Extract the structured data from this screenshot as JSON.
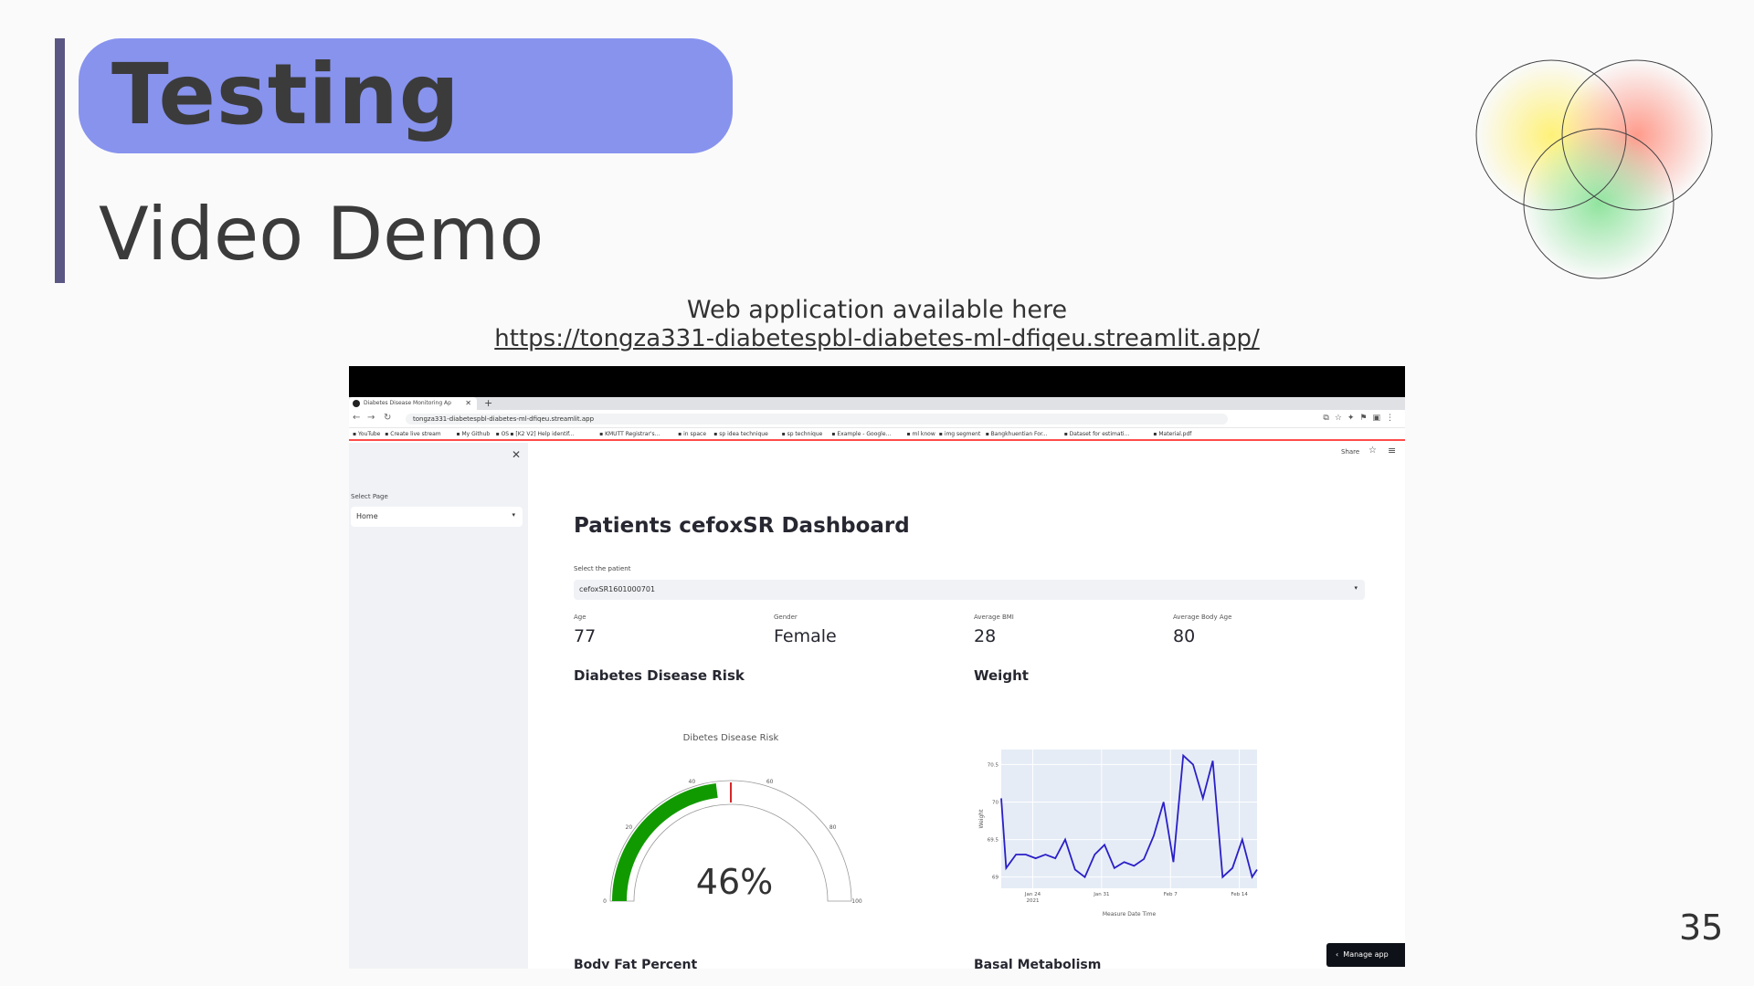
{
  "slide": {
    "title": "Testing",
    "subtitle": "Video Demo",
    "caption": "Web application available here",
    "link": "https://tongza331-diabetespbl-diabetes-ml-dfiqeu.streamlit.app/",
    "page_number": "35"
  },
  "browser": {
    "tab_title": "Diabetes Disease Monitoring Ap",
    "url": "tongza331-diabetespbl-diabetes-ml-dfiqeu.streamlit.app",
    "bookmarks": [
      "YouTube",
      "Create live stream",
      "My Github",
      "OS",
      "[K2 V2] Help identif...",
      "KMUTT Registrar's...",
      "in space",
      "sp idea technique",
      "sp technique",
      "Example - Google...",
      "ml know",
      "img segment",
      "Bangkhuentian For...",
      "Dataset for estimati...",
      "Material.pdf"
    ]
  },
  "sidebar": {
    "select_label": "Select Page",
    "select_value": "Home"
  },
  "header": {
    "share": "Share"
  },
  "dashboard": {
    "title": "Patients cefoxSR Dashboard",
    "patient_label": "Select the patient",
    "patient_value": "cefoxSR1601000701",
    "metrics": [
      {
        "label": "Age",
        "value": "77"
      },
      {
        "label": "Gender",
        "value": "Female"
      },
      {
        "label": "Average BMI",
        "value": "28"
      },
      {
        "label": "Average Body Age",
        "value": "80"
      }
    ],
    "risk_heading": "Diabetes Disease Risk",
    "weight_heading": "Weight",
    "bottom_left": "Body Fat Percent",
    "bottom_right": "Basal Metabolism",
    "manage_app": "Manage app"
  },
  "chart_data": [
    {
      "type": "gauge",
      "title": "Dibetes Disease Risk",
      "value": 46,
      "value_label": "46%",
      "range": [
        0,
        100
      ],
      "ticks": [
        "0",
        "20",
        "40",
        "60",
        "80",
        "100"
      ],
      "threshold": 50,
      "colors": {
        "bar": "#119a00",
        "threshold": "#d62728"
      }
    },
    {
      "type": "line",
      "title": "",
      "xlabel": "Measure Date Time",
      "ylabel": "Weight",
      "x_ticks": [
        "Jan 24\n2021",
        "Jan 31",
        "Feb 7",
        "Feb 14"
      ],
      "y_ticks": [
        "69",
        "69.5",
        "70",
        "70.5"
      ],
      "ylim": [
        68.85,
        70.7
      ],
      "x_range_days": [
        0,
        26
      ],
      "series": [
        {
          "color": "#2a1fc7",
          "x": [
            0,
            0.5,
            1.5,
            2.5,
            3.5,
            4.5,
            5.5,
            6.5,
            7.5,
            8.5,
            9.5,
            10.5,
            11.5,
            12.5,
            13.5,
            14.5,
            15.5,
            16.5,
            17.5,
            18.5,
            19.5,
            20.5,
            21.5,
            22.5,
            23.5,
            24.5,
            25.5,
            26
          ],
          "y": [
            70.05,
            69.12,
            69.3,
            69.3,
            69.25,
            69.3,
            69.25,
            69.5,
            69.1,
            69.0,
            69.3,
            69.43,
            69.12,
            69.2,
            69.15,
            69.24,
            69.55,
            70.0,
            69.2,
            70.62,
            70.5,
            70.05,
            70.55,
            69.0,
            69.12,
            69.5,
            69.0,
            69.1
          ]
        }
      ]
    }
  ]
}
